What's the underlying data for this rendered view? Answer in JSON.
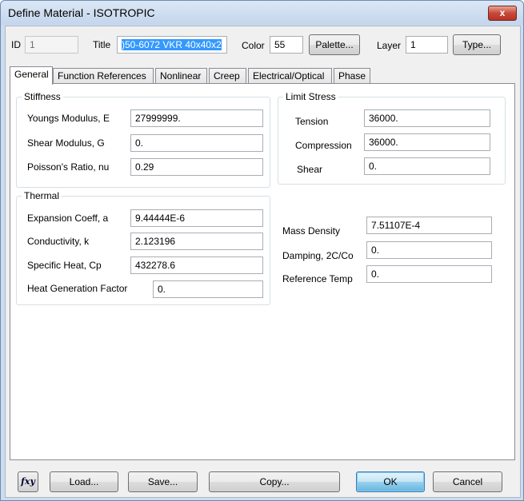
{
  "window": {
    "title": "Define Material - ISOTROPIC",
    "close_label": "x"
  },
  "header": {
    "id_label": "ID",
    "id_value": "1",
    "title_label": "Title",
    "title_value": ")50-6072 VKR 40x40x2",
    "color_label": "Color",
    "color_value": "55",
    "palette_label": "Palette...",
    "layer_label": "Layer",
    "layer_value": "1",
    "type_label": "Type..."
  },
  "tabs": [
    "General",
    "Function References",
    "Nonlinear",
    "Creep",
    "Electrical/Optical",
    "Phase"
  ],
  "stiffness": {
    "title": "Stiffness",
    "rows": [
      {
        "label": "Youngs Modulus, E",
        "value": "27999999."
      },
      {
        "label": "Shear Modulus, G",
        "value": "0."
      },
      {
        "label": "Poisson's Ratio, nu",
        "value": "0.29"
      }
    ]
  },
  "limit_stress": {
    "title": "Limit Stress",
    "rows": [
      {
        "label": "Tension",
        "value": "36000."
      },
      {
        "label": "Compression",
        "value": "36000."
      },
      {
        "label": "Shear",
        "value": "0."
      }
    ]
  },
  "thermal": {
    "title": "Thermal",
    "rows": [
      {
        "label": "Expansion Coeff, a",
        "value": "9.44444E-6"
      },
      {
        "label": "Conductivity, k",
        "value": "2.123196"
      },
      {
        "label": "Specific Heat, Cp",
        "value": "432278.6"
      },
      {
        "label": "Heat Generation Factor",
        "value": "0."
      }
    ]
  },
  "other": {
    "rows": [
      {
        "label": "Mass Density",
        "value": "7.51107E-4"
      },
      {
        "label": "Damping, 2C/Co",
        "value": "0."
      },
      {
        "label": "Reference Temp",
        "value": "0."
      }
    ]
  },
  "footer": {
    "fxy_label": "fxy",
    "load_label": "Load...",
    "save_label": "Save...",
    "copy_label": "Copy...",
    "ok_label": "OK",
    "cancel_label": "Cancel"
  }
}
